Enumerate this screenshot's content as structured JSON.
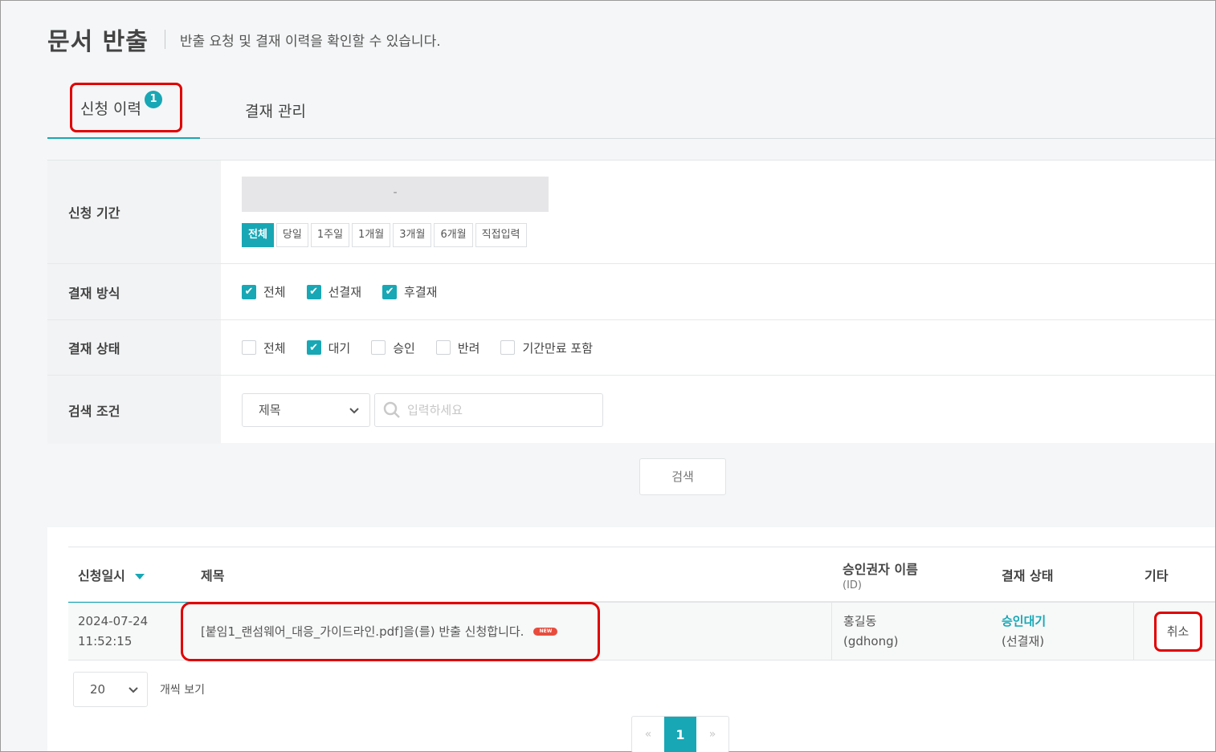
{
  "header": {
    "title": "문서 반출",
    "description": "반출 요청 및 결재 이력을 확인할 수 있습니다."
  },
  "tabs": [
    {
      "label": "신청 이력",
      "badge": "1",
      "active": true
    },
    {
      "label": "결재 관리",
      "active": false
    }
  ],
  "filters": {
    "period": {
      "label": "신청 기간",
      "date_range": "-",
      "buttons": [
        "전체",
        "당일",
        "1주일",
        "1개월",
        "3개월",
        "6개월",
        "직접입력"
      ],
      "selected": "전체"
    },
    "method": {
      "label": "결재 방식",
      "options": [
        {
          "label": "전체",
          "checked": true
        },
        {
          "label": "선결재",
          "checked": true
        },
        {
          "label": "후결재",
          "checked": true
        }
      ]
    },
    "status": {
      "label": "결재 상태",
      "options": [
        {
          "label": "전체",
          "checked": false
        },
        {
          "label": "대기",
          "checked": true
        },
        {
          "label": "승인",
          "checked": false
        },
        {
          "label": "반려",
          "checked": false
        },
        {
          "label": "기간만료 포함",
          "checked": false
        }
      ]
    },
    "search": {
      "label": "검색 조건",
      "field_selected": "제목",
      "placeholder": "입력하세요"
    }
  },
  "search_button": "검색",
  "table": {
    "headers": {
      "date": "신청일시",
      "title": "제목",
      "approver": "승인권자 이름",
      "approver_sub": "(ID)",
      "status": "결재 상태",
      "etc": "기타"
    },
    "rows": [
      {
        "date": "2024-07-24",
        "time": "11:52:15",
        "title": "[붙임1_랜섬웨어_대응_가이드라인.pdf]을(를) 반출 신청합니다.",
        "new_badge": "NEW",
        "approver_name": "홍길동",
        "approver_id": "(gdhong)",
        "status": "승인대기",
        "status_sub": "(선결재)",
        "action": "취소"
      }
    ]
  },
  "pagination": {
    "page_size": "20",
    "page_size_label": "개씩 보기",
    "prev": "«",
    "current": "1",
    "next": "»"
  },
  "colors": {
    "accent": "#18a7b5",
    "highlight_border": "#e00000",
    "new_badge": "#e84c3d"
  }
}
